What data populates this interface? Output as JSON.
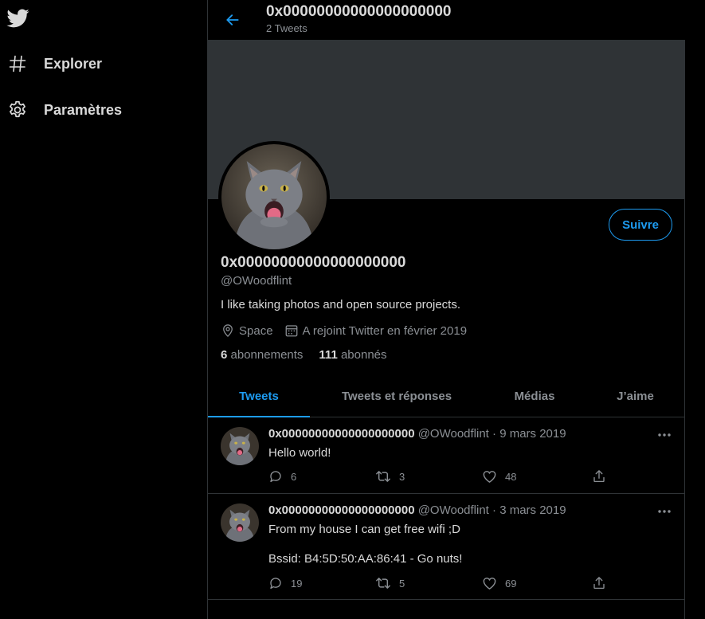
{
  "sidebar": {
    "items": [
      {
        "label": "Explorer",
        "icon": "hashtag-icon"
      },
      {
        "label": "Paramètres",
        "icon": "gear-icon"
      }
    ]
  },
  "header": {
    "title": "0x00000000000000000000",
    "subtitle": "2 Tweets"
  },
  "profile": {
    "name": "0x00000000000000000000",
    "handle": "@OWoodflint",
    "bio": "I like taking photos and open source projects.",
    "location": "Space",
    "joined": "A rejoint Twitter en février 2019",
    "following_count": "6",
    "following_label": "abonnements",
    "followers_count": "111",
    "followers_label": "abonnés",
    "follow_label": "Suivre"
  },
  "tabs": [
    {
      "label": "Tweets",
      "active": true
    },
    {
      "label": "Tweets et réponses",
      "active": false
    },
    {
      "label": "Médias",
      "active": false
    },
    {
      "label": "J’aime",
      "active": false
    }
  ],
  "tweets": [
    {
      "name": "0x00000000000000000000",
      "handle": "@OWoodflint",
      "separator": "·",
      "date": "9 mars 2019",
      "lines": [
        "Hello world!"
      ],
      "replies": "6",
      "retweets": "3",
      "likes": "48"
    },
    {
      "name": "0x00000000000000000000",
      "handle": "@OWoodflint",
      "separator": "·",
      "date": "3 mars 2019",
      "lines": [
        "From my house I can get free wifi ;D",
        "",
        "Bssid: B4:5D:50:AA:86:41 - Go nuts!"
      ],
      "replies": "19",
      "retweets": "5",
      "likes": "69"
    }
  ],
  "colors": {
    "accent": "#1d9bf0",
    "background": "#000000",
    "banner": "#2f3336",
    "text": "#d9d9d9",
    "muted": "#8b8f94"
  }
}
